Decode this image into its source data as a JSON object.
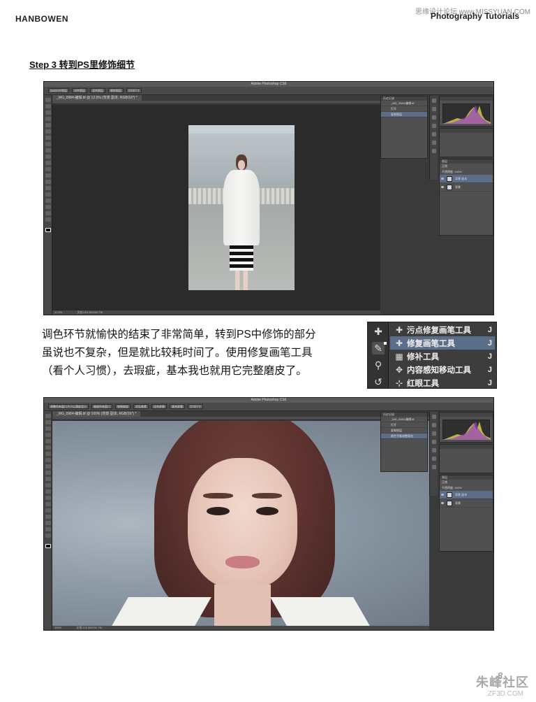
{
  "header": {
    "brand": "HANBOWEN",
    "series": "Photography Tutorials",
    "watermark": "思缘设计论坛 www.MISSYUAN.COM"
  },
  "step": {
    "title": "Step 3 转到PS里修饰细节"
  },
  "ps_window_1": {
    "app_title": "Adobe Photoshop CS6",
    "options_buttons": [
      "自动对齐图层",
      "对齐图层",
      "混合图层",
      "裁剪图层",
      "打印尺寸"
    ],
    "doc_tab": "_MG_0984-编辑.tif @ 12.5% (背景 副本, RGB/16*) *",
    "status": "12.5%",
    "status_doc": "文档:116.3M/232.7M",
    "history_title": "历史记录",
    "history": [
      "_MG_0984-编辑.tif",
      "打开",
      "复制图层"
    ],
    "layers_title": "图层",
    "layers": [
      "背景 副本",
      "背景"
    ],
    "blend_mode": "正常",
    "opacity": "不透明度: 100%"
  },
  "paragraph": {
    "lines": [
      "调色环节就愉快的结束了非常简单，转到PS中修饰的部分",
      "虽说也不复杂，但是就比较耗时间了。使用修复画笔工具",
      "（看个人习惯），去瑕疵，基本我也就用它完整磨皮了。"
    ]
  },
  "tool_flyout": {
    "items": [
      {
        "label": "污点修复画笔工具",
        "key": "J",
        "icon": "spot-healing-brush-icon"
      },
      {
        "label": "修复画笔工具",
        "key": "J",
        "icon": "healing-brush-icon",
        "active": true
      },
      {
        "label": "修补工具",
        "key": "J",
        "icon": "patch-tool-icon"
      },
      {
        "label": "内容感知移动工具",
        "key": "J",
        "icon": "content-aware-move-icon"
      },
      {
        "label": "红眼工具",
        "key": "J",
        "icon": "red-eye-icon"
      }
    ]
  },
  "ps_window_2": {
    "app_title": "Adobe Photoshop CS6",
    "options_buttons": [
      "调整所有窗口大小以满屏显示",
      "缩放所有窗口",
      "细微缩放",
      "实际像素",
      "适合屏幕",
      "填充屏幕",
      "打印尺寸"
    ],
    "doc_tab": "_MG_0984-编辑.tif @ 100% (背景 副本, RGB/16*) *",
    "status": "100%",
    "status_doc": "文档:116.3M/232.7M",
    "history_title": "历史记录",
    "history": [
      "_MG_0984-编辑.tif",
      "打开",
      "复制图层",
      "颜色平衡调整填充"
    ],
    "layers_title": "图层",
    "layers": [
      "背景 副本",
      "背景"
    ],
    "blend_mode": "正常",
    "opacity": "不透明度: 100%"
  },
  "footer": {
    "page_number": "8",
    "site": "朱峰社区",
    "site_url": "ZF3D.COM"
  }
}
